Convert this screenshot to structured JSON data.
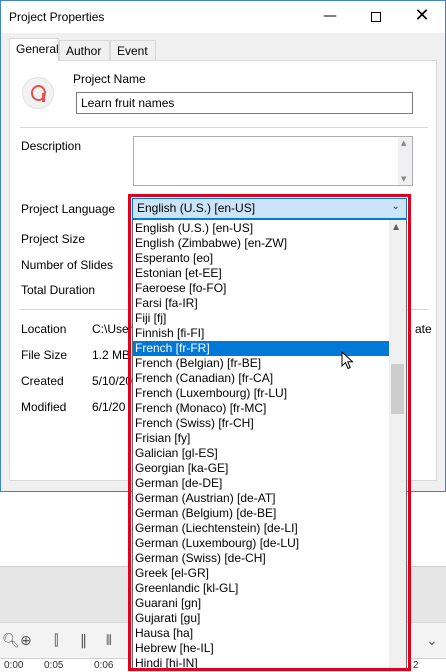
{
  "window": {
    "title": "Project Properties"
  },
  "tabs": [
    {
      "label": "General"
    },
    {
      "label": "Author"
    },
    {
      "label": "Event"
    }
  ],
  "general": {
    "project_name_label": "Project Name",
    "project_name_value": "Learn fruit names",
    "description_label": "Description",
    "description_value": "",
    "language_label": "Project Language",
    "language_selected": "English (U.S.) [en-US]",
    "size_label": "Project Size",
    "slides_label": "Number of Slides",
    "duration_label": "Total Duration",
    "location_label": "Location",
    "location_value": "C:\\User",
    "location_value_tail": "ate",
    "filesize_label": "File Size",
    "filesize_value": "1.2 MB",
    "created_label": "Created",
    "created_value": "5/10/20",
    "modified_label": "Modified",
    "modified_value": "6/1/20"
  },
  "language_options": [
    "English (U.S.) [en-US]",
    "English (Zimbabwe) [en-ZW]",
    "Esperanto [eo]",
    "Estonian [et-EE]",
    "Faeroese [fo-FO]",
    "Farsi [fa-IR]",
    "Fiji [fj]",
    "Finnish [fi-FI]",
    "French [fr-FR]",
    "French (Belgian) [fr-BE]",
    "French (Canadian) [fr-CA]",
    "French (Luxembourg) [fr-LU]",
    "French (Monaco) [fr-MC]",
    "French (Swiss) [fr-CH]",
    "Frisian [fy]",
    "Galician [gl-ES]",
    "Georgian [ka-GE]",
    "German [de-DE]",
    "German (Austrian) [de-AT]",
    "German (Belgium) [de-BE]",
    "German (Liechtenstein) [de-LI]",
    "German (Luxembourg) [de-LU]",
    "German (Swiss) [de-CH]",
    "Greek [el-GR]",
    "Greenlandic [kl-GL]",
    "Guarani [gn]",
    "Gujarati [gu]",
    "Hausa [ha]",
    "Hebrew [he-IL]",
    "Hindi [hi-IN]"
  ],
  "highlighted_option": "French [fr-FR]",
  "timeline": {
    "ticks": [
      "0:00",
      "0:05",
      "0:06",
      "2"
    ]
  },
  "colors": {
    "highlight": "#0078d7",
    "annotation": "#e0001b",
    "logo": "#e6514c"
  }
}
